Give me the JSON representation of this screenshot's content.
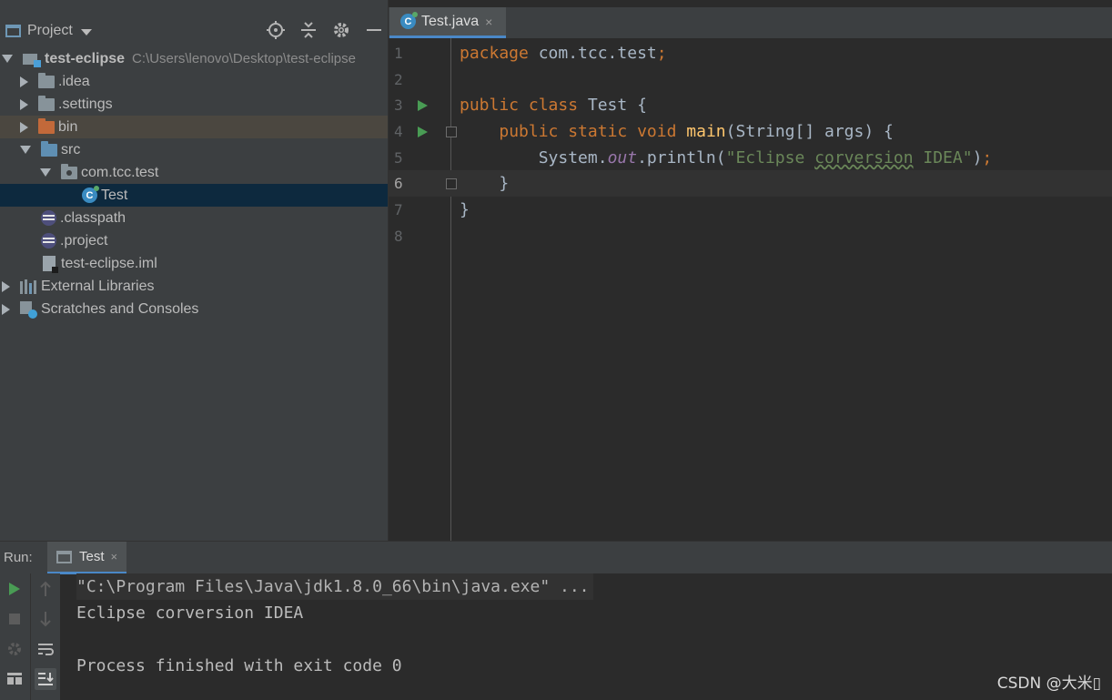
{
  "project_panel": {
    "title": "Project",
    "tree": {
      "root_name": "test-eclipse",
      "root_path": "C:\\Users\\lenovo\\Desktop\\test-eclipse",
      "idea": ".idea",
      "settings": ".settings",
      "bin": "bin",
      "src": "src",
      "package": "com.tcc.test",
      "class": "Test",
      "classpath": ".classpath",
      "project": ".project",
      "iml": "test-eclipse.iml",
      "external_libraries": "External Libraries",
      "scratches": "Scratches and Consoles"
    }
  },
  "editor": {
    "tab_label": "Test.java",
    "tab_close": "×",
    "line_numbers": [
      "1",
      "2",
      "3",
      "4",
      "5",
      "6",
      "7",
      "8"
    ],
    "code": {
      "l1_kw": "package",
      "l1_rest": " com.tcc.test",
      "l1_semi": ";",
      "l3_kw": "public class",
      "l3_rest": " Test {",
      "l4_kw": "public static void",
      "l4_fn": "main",
      "l4_rest": "(String[] args) {",
      "l5_a": "System.",
      "l5_out": "out",
      "l5_b": ".println(",
      "l5_str1": "\"Eclipse ",
      "l5_typo": "corversion",
      "l5_str2": " IDEA\"",
      "l5_c": ")",
      "l5_semi": ";",
      "l6": "}",
      "l7": "}"
    }
  },
  "run_panel": {
    "label": "Run:",
    "tab_label": "Test",
    "tab_close": "×",
    "console": {
      "cmd": "\"C:\\Program Files\\Java\\jdk1.8.0_66\\bin\\java.exe\" ...",
      "output": "Eclipse corversion IDEA",
      "blank": "",
      "exit": "Process finished with exit code 0"
    }
  },
  "watermark": "CSDN @大米▯",
  "colors": {
    "keyword": "#cc7832",
    "function": "#ffc66d",
    "string": "#6a8759",
    "static_field": "#9876aa",
    "selection": "#0d293e",
    "accent": "#4a88c7"
  }
}
